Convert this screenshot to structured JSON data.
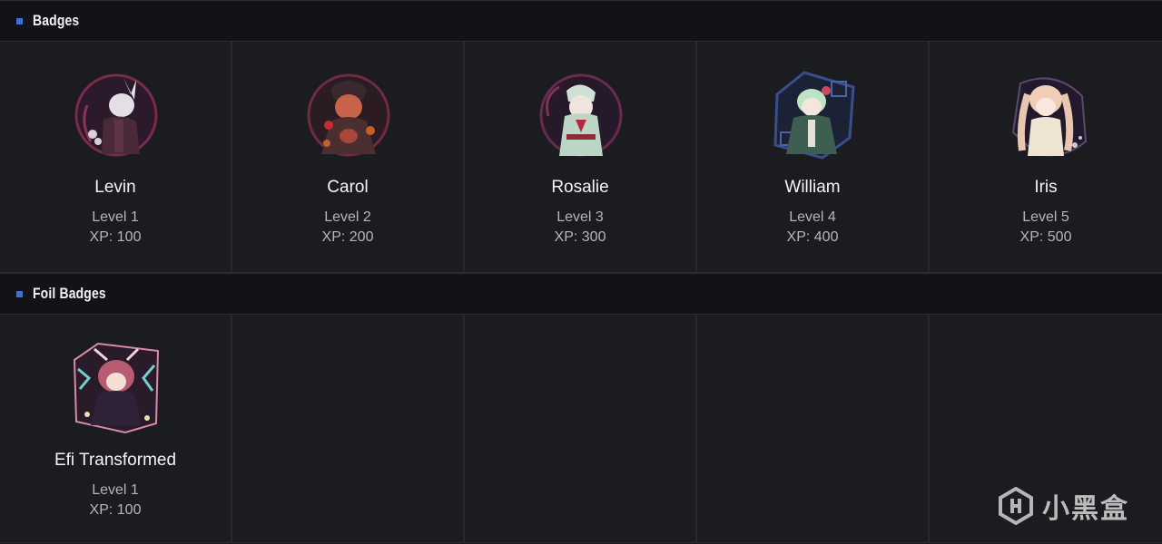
{
  "sections": [
    {
      "title": "Badges",
      "badges": [
        {
          "name": "Levin",
          "level": "Level 1",
          "xp": "XP: 100"
        },
        {
          "name": "Carol",
          "level": "Level 2",
          "xp": "XP: 200"
        },
        {
          "name": "Rosalie",
          "level": "Level 3",
          "xp": "XP: 300"
        },
        {
          "name": "William",
          "level": "Level 4",
          "xp": "XP: 400"
        },
        {
          "name": "Iris",
          "level": "Level 5",
          "xp": "XP: 500"
        }
      ]
    },
    {
      "title": "Foil Badges",
      "badges": [
        {
          "name": "Efi Transformed",
          "level": "Level 1",
          "xp": "XP: 100"
        }
      ]
    }
  ],
  "watermark": {
    "text": "小黑盒"
  },
  "colors": {
    "accent": "#3f6fd3",
    "background": "#1b1c20",
    "header": "#121316"
  }
}
